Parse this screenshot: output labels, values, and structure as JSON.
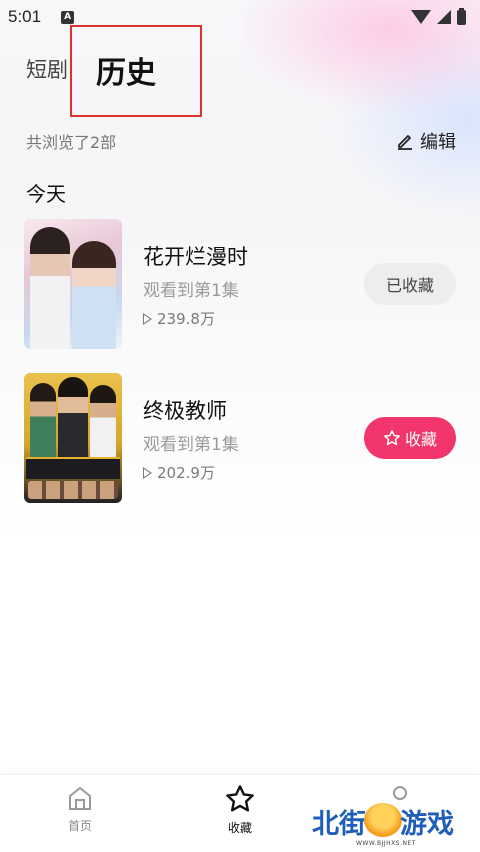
{
  "status_bar": {
    "time": "5:01",
    "notification_icon": "A"
  },
  "header": {
    "tabs": [
      {
        "label": "短剧",
        "active": false
      },
      {
        "label": "历史",
        "active": true
      }
    ]
  },
  "summary": {
    "text": "共浏览了2部",
    "edit_label": "编辑"
  },
  "section": {
    "title": "今天"
  },
  "history_items": [
    {
      "title": "花开烂漫时",
      "progress": "观看到第1集",
      "views": "239.8万",
      "favorite_label": "已收藏",
      "favorited": true
    },
    {
      "title": "终极教师",
      "progress": "观看到第1集",
      "views": "202.9万",
      "favorite_label": "收藏",
      "favorited": false
    }
  ],
  "bottom_nav": {
    "items": [
      {
        "label": "首页",
        "icon": "home-icon",
        "active": false
      },
      {
        "label": "收藏",
        "icon": "star-icon",
        "active": true
      },
      {
        "label": "",
        "icon": "profile-icon",
        "active": false
      }
    ]
  },
  "watermark": {
    "left": "北街",
    "right": "游戏",
    "url": "WWW.BJJHXS.NET"
  },
  "colors": {
    "accent": "#f2356a",
    "highlight_box": "#d9342b",
    "favorited_bg": "#ededee"
  }
}
